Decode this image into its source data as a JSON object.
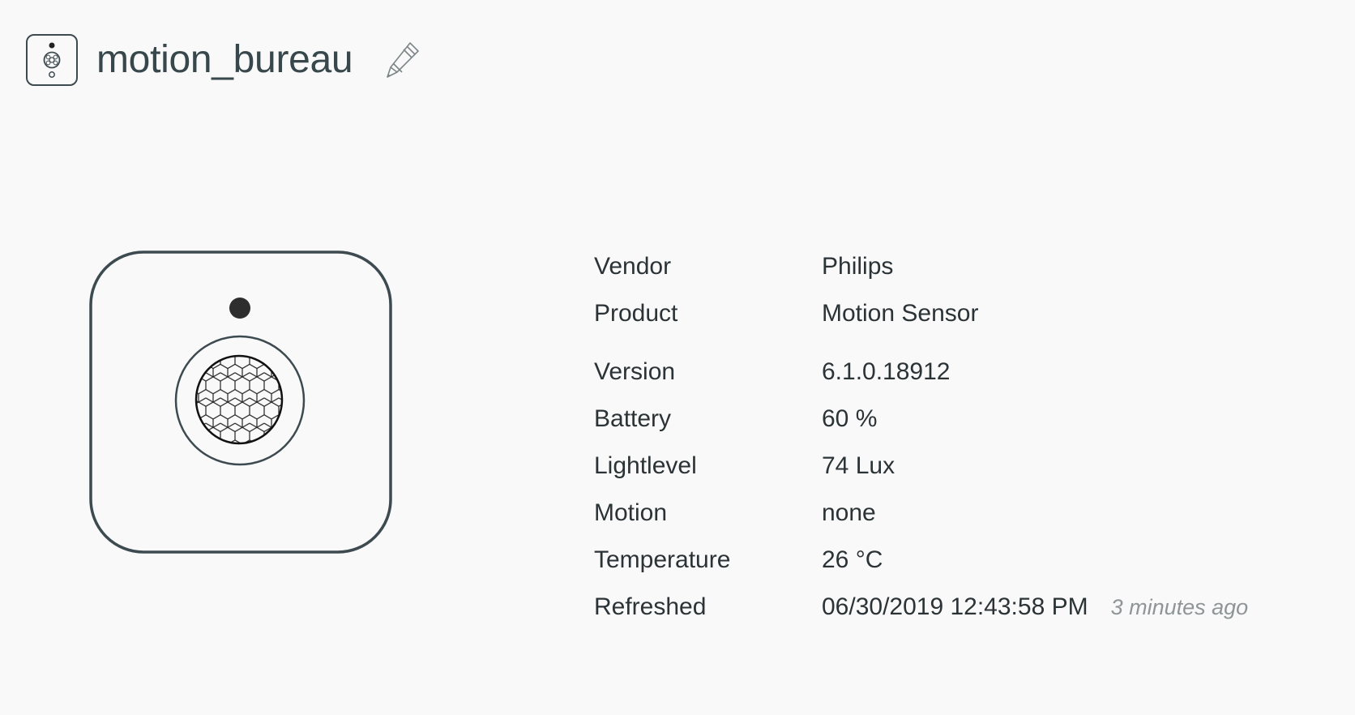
{
  "device": {
    "name": "motion_bureau",
    "icon": "motion-sensor-icon",
    "edit_icon": "pencil-icon"
  },
  "details": {
    "vendor": {
      "label": "Vendor",
      "value": "Philips"
    },
    "product": {
      "label": "Product",
      "value": "Motion Sensor"
    },
    "version": {
      "label": "Version",
      "value": "6.1.0.18912"
    },
    "battery": {
      "label": "Battery",
      "value": "60 %"
    },
    "lightlevel": {
      "label": "Lightlevel",
      "value": "74 Lux"
    },
    "motion": {
      "label": "Motion",
      "value": "none"
    },
    "temperature": {
      "label": "Temperature",
      "value": "26 °C"
    },
    "refreshed": {
      "label": "Refreshed",
      "value": "06/30/2019 12:43:58 PM",
      "relative": "3 minutes ago"
    }
  },
  "colors": {
    "background": "#f9f9f9",
    "outline": "#3d4a4f",
    "text": "#2b3336",
    "muted": "#8f9597"
  }
}
